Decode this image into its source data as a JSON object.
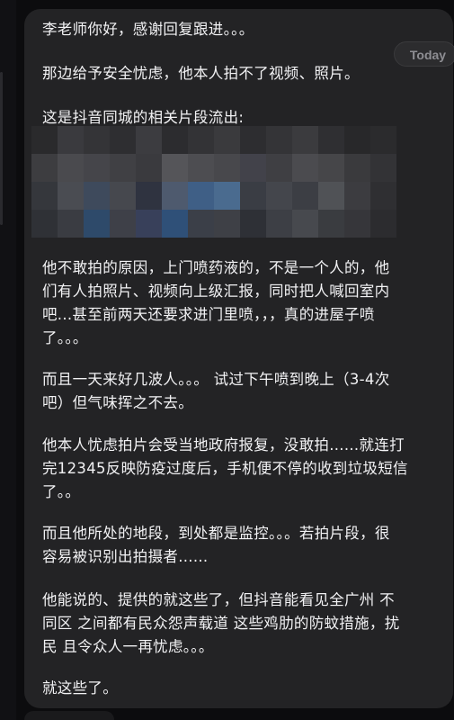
{
  "message": {
    "time": "Today",
    "paragraphs": [
      "李老师你好，感谢回复跟进。。。",
      "那边给予安全忧虑，他本人拍不了视频、照片。",
      "这是抖音同城的相关片段流出:",
      "他不敢拍的原因，上门喷药液的，不是一个人的，他\n们有人拍照片、视频向上级汇报，同时把人喊回室内\n吧...甚至前两天还要求进门里喷，，，真的进屋子喷\n了。。。",
      "而且一天来好几波人。。。 试过下午喷到晚上（3-4次\n吧）但气味挥之不去。",
      "他本人忧虑拍片会受当地政府报复，没敢拍......就连打\n完12345反映防疫过度后，手机便不停的收到垃圾短信\n了。。",
      "而且他所处的地段，到处都是监控。。。若拍片段，很\n容易被识别出拍摄者......",
      "他能说的、提供的就这些了，但抖音能看见全广州 不\n同区 之间都有民众怨声载道 这些鸡肋的防蚊措施，扰\n民 且令众人一再忧虑。。。",
      "就这些了。"
    ]
  },
  "colors": {
    "bubble": "#232325",
    "background": "#0c0c0e",
    "text": "#f2f2f4",
    "time": "#8e8e93"
  }
}
